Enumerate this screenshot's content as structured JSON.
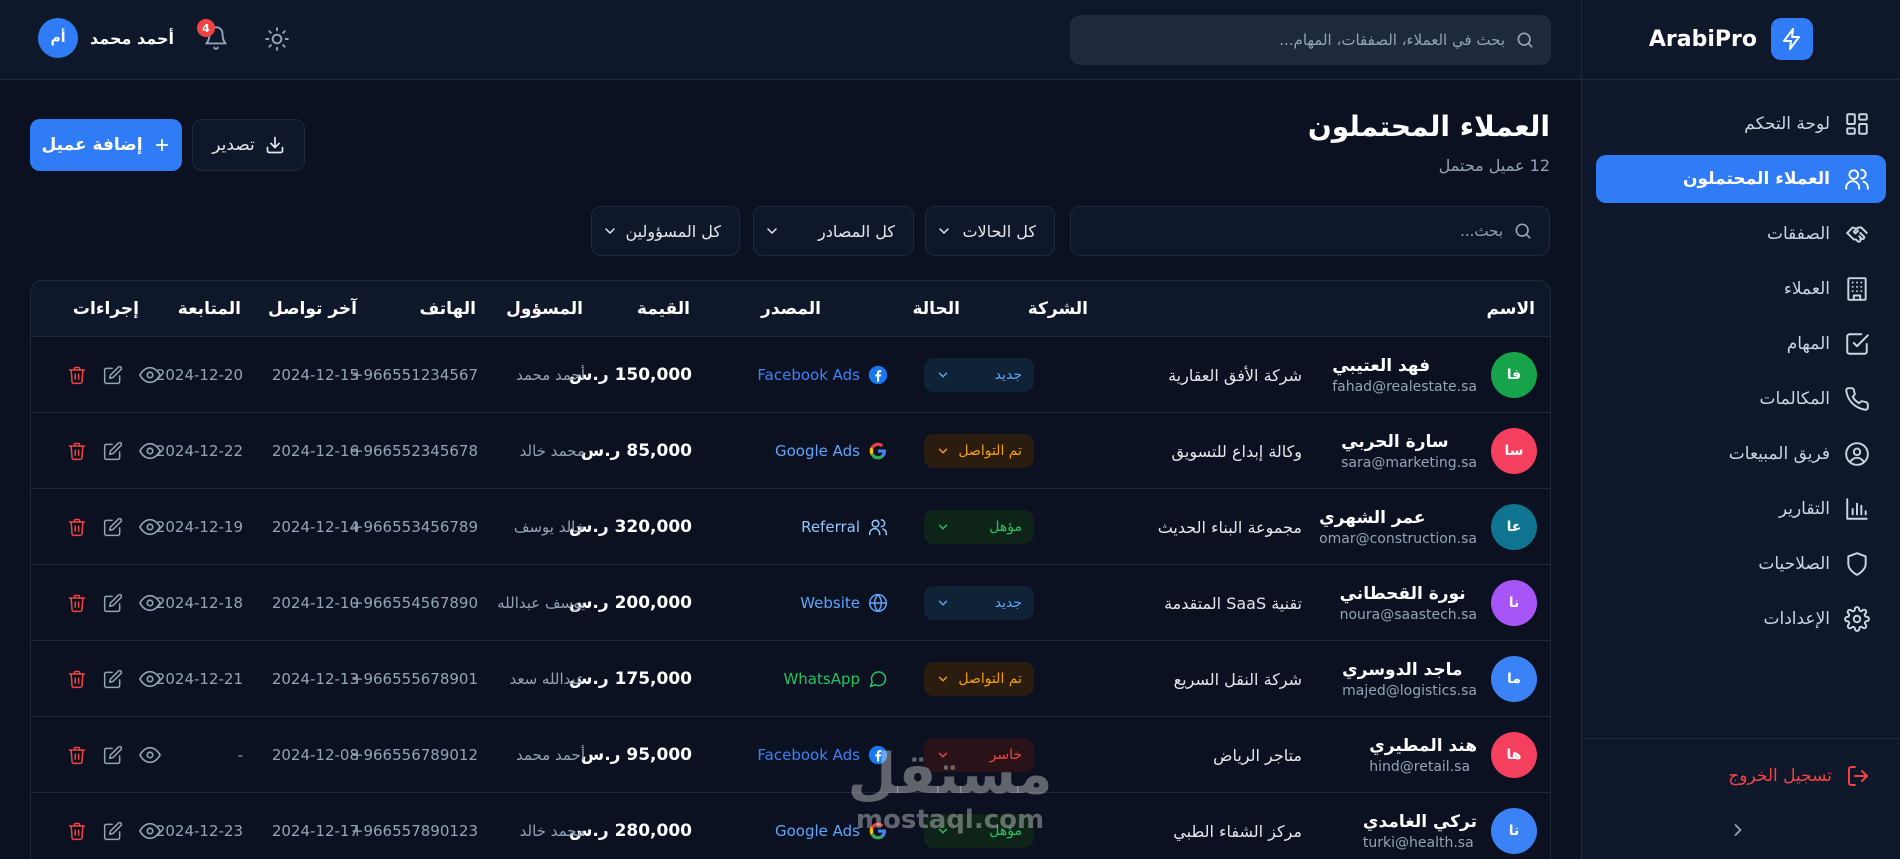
{
  "app": {
    "name": "ArabiPro"
  },
  "sidebar": {
    "items": [
      {
        "label": "لوحة التحكم",
        "icon": "dashboard-grid-icon"
      },
      {
        "label": "العملاء المحتملون",
        "icon": "users-icon",
        "active": true
      },
      {
        "label": "الصفقات",
        "icon": "handshake-icon"
      },
      {
        "label": "العملاء",
        "icon": "building-icon"
      },
      {
        "label": "المهام",
        "icon": "checkbox-icon"
      },
      {
        "label": "المكالمات",
        "icon": "phone-icon"
      },
      {
        "label": "فريق المبيعات",
        "icon": "user-circle-icon"
      },
      {
        "label": "التقارير",
        "icon": "bar-chart-icon"
      },
      {
        "label": "الصلاحيات",
        "icon": "shield-icon"
      },
      {
        "label": "الإعدادات",
        "icon": "gear-icon"
      }
    ],
    "logout": "تسجيل الخروج"
  },
  "header": {
    "search_placeholder": "بحث في العملاء، الصفقات، المهام...",
    "notifications_count": "4",
    "user_name": "أحمد محمد",
    "user_initials": "أم"
  },
  "page": {
    "title": "العملاء المحتملون",
    "subtitle": "12 عميل محتمل",
    "add_label": "إضافة عميل",
    "export_label": "تصدير",
    "search_placeholder": "بحث...",
    "filter_status": "كل الحالات",
    "filter_source": "كل المصادر",
    "filter_owner": "كل المسؤولين"
  },
  "table": {
    "headers": {
      "name": "الاسم",
      "company": "الشركة",
      "status": "الحالة",
      "source": "المصدر",
      "value": "القيمة",
      "owner": "المسؤول",
      "phone": "الهاتف",
      "last_contact": "آخر تواصل",
      "followup": "المتابعة",
      "actions": "إجراءات"
    },
    "rows": [
      {
        "initials": "فا",
        "avatar_color": "#16a34a",
        "name": "فهد العتيبي",
        "email": "fahad@realestate.sa",
        "company": "شركة الأفق العقارية",
        "status": "جديد",
        "status_kind": "new",
        "source": "Facebook Ads",
        "source_icon": "facebook-icon",
        "source_color": "#3b82f6",
        "value": "150,000 ر.س",
        "owner": "أحمد محمد",
        "phone": "+966551234567",
        "last_contact": "2024-12-15",
        "followup": "2024-12-20"
      },
      {
        "initials": "سا",
        "avatar_color": "#f43f5e",
        "name": "سارة الحربي",
        "email": "sara@marketing.sa",
        "company": "وكالة إبداع للتسويق",
        "status": "تم التواصل",
        "status_kind": "contacted",
        "source": "Google Ads",
        "source_icon": "google-icon",
        "source_color": "#60a5fa",
        "value": "85,000 ر.س",
        "owner": "محمد خالد",
        "phone": "+966552345678",
        "last_contact": "2024-12-16",
        "followup": "2024-12-22"
      },
      {
        "initials": "عا",
        "avatar_color": "#0e7490",
        "name": "عمر الشهري",
        "email": "omar@construction.sa",
        "company": "مجموعة البناء الحديث",
        "status": "مؤهل",
        "status_kind": "qualified",
        "source": "Referral",
        "source_icon": "people-icon",
        "source_color": "#93c5fd",
        "value": "320,000 ر.س",
        "owner": "خالد يوسف",
        "phone": "+966553456789",
        "last_contact": "2024-12-14",
        "followup": "2024-12-19"
      },
      {
        "initials": "نا",
        "avatar_color": "#a855f7",
        "name": "نورة القحطاني",
        "email": "noura@saastech.sa",
        "company": "تقنية SaaS المتقدمة",
        "status": "جديد",
        "status_kind": "new",
        "source": "Website",
        "source_icon": "globe-icon",
        "source_color": "#60a5fa",
        "value": "200,000 ر.س",
        "owner": "يوسف عبدالله",
        "phone": "+966554567890",
        "last_contact": "2024-12-10",
        "followup": "2024-12-18"
      },
      {
        "initials": "ما",
        "avatar_color": "#3b82f6",
        "name": "ماجد الدوسري",
        "email": "majed@logistics.sa",
        "company": "شركة النقل السريع",
        "status": "تم التواصل",
        "status_kind": "contacted",
        "source": "WhatsApp",
        "source_icon": "whatsapp-icon",
        "source_color": "#22c55e",
        "value": "175,000 ر.س",
        "owner": "عبدالله سعد",
        "phone": "+966555678901",
        "last_contact": "2024-12-13",
        "followup": "2024-12-21"
      },
      {
        "initials": "ها",
        "avatar_color": "#f43f5e",
        "name": "هند المطيري",
        "email": "hind@retail.sa",
        "company": "متاجر الرياض",
        "status": "خاسر",
        "status_kind": "lost",
        "source": "Facebook Ads",
        "source_icon": "facebook-icon",
        "source_color": "#3b82f6",
        "value": "95,000 ر.س",
        "owner": "أحمد محمد",
        "phone": "+966556789012",
        "last_contact": "2024-12-08",
        "followup": "-"
      },
      {
        "initials": "تا",
        "avatar_color": "#3b82f6",
        "name": "تركي الغامدي",
        "email": "turki@health.sa",
        "company": "مركز الشفاء الطبي",
        "status": "مؤهل",
        "status_kind": "qualified",
        "source": "Google Ads",
        "source_icon": "google-icon",
        "source_color": "#60a5fa",
        "value": "280,000 ر.س",
        "owner": "محمد خالد",
        "phone": "+966557890123",
        "last_contact": "2024-12-17",
        "followup": "2024-12-23"
      }
    ]
  },
  "status_styles": {
    "new": {
      "bg": "#0f2236",
      "fg": "#60a5fa"
    },
    "contacted": {
      "bg": "#2a1d0f",
      "fg": "#f59e0b"
    },
    "qualified": {
      "bg": "#0f2419",
      "fg": "#22c55e"
    },
    "lost": {
      "bg": "#2a1318",
      "fg": "#ef4444"
    }
  },
  "colors": {
    "accent": "#2f7cf6",
    "danger": "#ef4444",
    "background": "#0b1120"
  },
  "watermark": {
    "arabic": "مستقل",
    "latin": "mostaql.com"
  }
}
